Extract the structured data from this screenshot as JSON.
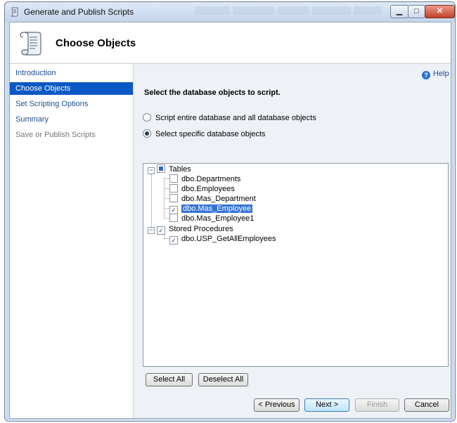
{
  "window": {
    "title": "Generate and Publish Scripts"
  },
  "header": {
    "title": "Choose Objects"
  },
  "nav": {
    "items": [
      {
        "label": "Introduction",
        "state": "link"
      },
      {
        "label": "Choose Objects",
        "state": "active"
      },
      {
        "label": "Set Scripting Options",
        "state": "link"
      },
      {
        "label": "Summary",
        "state": "link"
      },
      {
        "label": "Save or Publish Scripts",
        "state": "disabled"
      }
    ]
  },
  "help": {
    "label": "Help"
  },
  "main": {
    "instruction": "Select the database objects to script.",
    "radio_entire": "Script entire database and all database objects",
    "radio_specific": "Select specific database objects",
    "selected_option": "specific"
  },
  "tree": {
    "tables_label": "Tables",
    "tables": [
      {
        "name": "dbo.Departments",
        "checked": false
      },
      {
        "name": "dbo.Employees",
        "checked": false
      },
      {
        "name": "dbo.Mas_Department",
        "checked": false
      },
      {
        "name": "dbo.Mas_Employee",
        "checked": true
      },
      {
        "name": "dbo.Mas_Employee1",
        "checked": false
      }
    ],
    "procs_label": "Stored Procedures",
    "procs": [
      {
        "name": "dbo.USP_GetAllEmployees",
        "checked": true
      }
    ]
  },
  "buttons": {
    "select_all": "Select All",
    "deselect_all": "Deselect All",
    "previous": "< Previous",
    "next": "Next >",
    "finish": "Finish",
    "cancel": "Cancel"
  },
  "colors": {
    "accent": "#0a58c6",
    "link": "#1f4f96"
  }
}
